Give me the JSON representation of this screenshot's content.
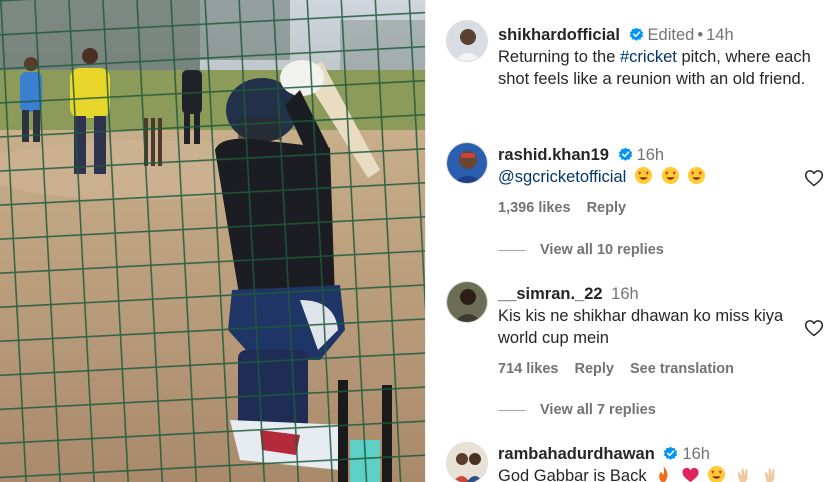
{
  "post": {
    "author": "shikhardofficial",
    "edited_label": "Edited",
    "time": "14h",
    "caption_before": "Returning to the ",
    "hashtag": "#cricket",
    "caption_after": " pitch, where each shot feels like a reunion with an old friend."
  },
  "comments": [
    {
      "username": "rashid.khan19",
      "verified": true,
      "time": "16h",
      "mention": "@sgcricketofficial",
      "text": "",
      "emojis": [
        "heart-eyes",
        "heart-eyes",
        "heart-eyes"
      ],
      "likes": "1,396 likes",
      "reply_label": "Reply",
      "view_replies": "View all 10 replies"
    },
    {
      "username": "__simran._22",
      "verified": false,
      "time": "16h",
      "text": "Kis kis ne shikhar dhawan ko miss kiya world cup mein",
      "likes": "714 likes",
      "reply_label": "Reply",
      "see_translation": "See translation",
      "view_replies": "View all 7 replies"
    },
    {
      "username": "rambahadurdhawan",
      "verified": true,
      "time": "16h",
      "text": "God Gabbar is Back",
      "emojis": [
        "fire",
        "heart",
        "heart-eyes",
        "clap",
        "clap"
      ]
    }
  ],
  "icons": {
    "verified": "verified-badge-icon",
    "like": "heart-outline-icon"
  },
  "colors": {
    "verified_blue": "#0095f6",
    "hashtag_link": "#00376b",
    "secondary_text": "#737373"
  }
}
